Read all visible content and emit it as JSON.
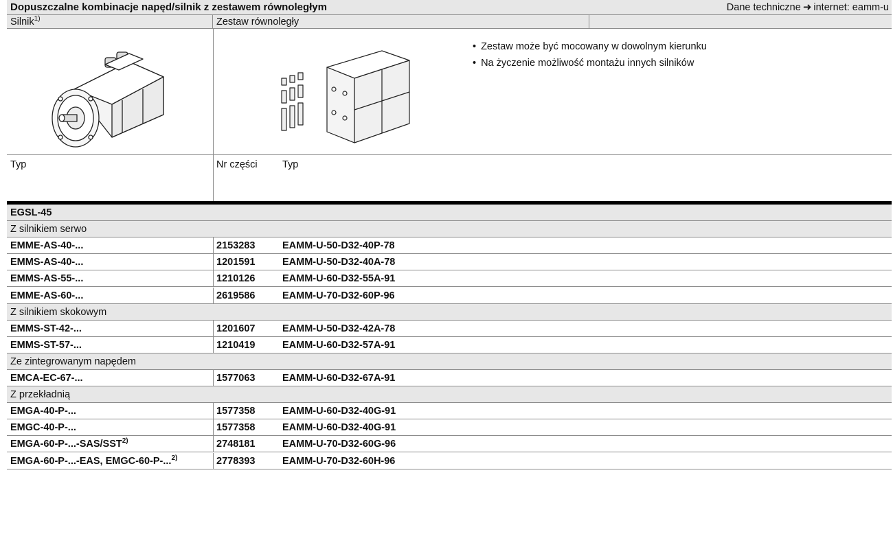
{
  "header": {
    "title": "Dopuszczalne kombinacje napęd/silnik z zestawem równoległym",
    "link_prefix": "Dane techniczne",
    "link_text": "internet: eamm-u"
  },
  "column_headers": {
    "motor": "Silnik",
    "motor_footnote": "1)",
    "kit": "Zestaw równoległy",
    "type": "Typ",
    "part_no": "Nr części",
    "kit_type": "Typ"
  },
  "notes": [
    "Zestaw może być mocowany w dowolnym kierunku",
    "Na życzenie możliwość montażu innych silników"
  ],
  "images": {
    "motor": "servo-motor-drawing",
    "kit": "parallel-kit-drawing"
  },
  "section": "EGSL-45",
  "groups": [
    {
      "title": "Z silnikiem serwo",
      "rows": [
        {
          "motor": "EMME-AS-40-...",
          "footnote": "",
          "part": "2153283",
          "type": "EAMM-U-50-D32-40P-78"
        },
        {
          "motor": "EMMS-AS-40-...",
          "footnote": "",
          "part": "1201591",
          "type": "EAMM-U-50-D32-40A-78"
        },
        {
          "motor": "EMMS-AS-55-...",
          "footnote": "",
          "part": "1210126",
          "type": "EAMM-U-60-D32-55A-91"
        },
        {
          "motor": "EMME-AS-60-...",
          "footnote": "",
          "part": "2619586",
          "type": "EAMM-U-70-D32-60P-96"
        }
      ]
    },
    {
      "title": "Z silnikiem skokowym",
      "rows": [
        {
          "motor": "EMMS-ST-42-...",
          "footnote": "",
          "part": "1201607",
          "type": "EAMM-U-50-D32-42A-78"
        },
        {
          "motor": "EMMS-ST-57-...",
          "footnote": "",
          "part": "1210419",
          "type": "EAMM-U-60-D32-57A-91"
        }
      ]
    },
    {
      "title": "Ze zintegrowanym napędem",
      "rows": [
        {
          "motor": "EMCA-EC-67-...",
          "footnote": "",
          "part": "1577063",
          "type": "EAMM-U-60-D32-67A-91"
        }
      ]
    },
    {
      "title": "Z przekładnią",
      "rows": [
        {
          "motor": "EMGA-40-P-...",
          "footnote": "",
          "part": "1577358",
          "type": "EAMM-U-60-D32-40G-91"
        },
        {
          "motor": "EMGC-40-P-...",
          "footnote": "",
          "part": "1577358",
          "type": "EAMM-U-60-D32-40G-91"
        },
        {
          "motor": "EMGA-60-P-...-SAS/SST",
          "footnote": "2)",
          "part": "2748181",
          "type": "EAMM-U-70-D32-60G-96"
        },
        {
          "motor": "EMGA-60-P-...-EAS, EMGC-60-P-...",
          "footnote": "2)",
          "part": "2778393",
          "type": "EAMM-U-70-D32-60H-96"
        }
      ]
    }
  ]
}
